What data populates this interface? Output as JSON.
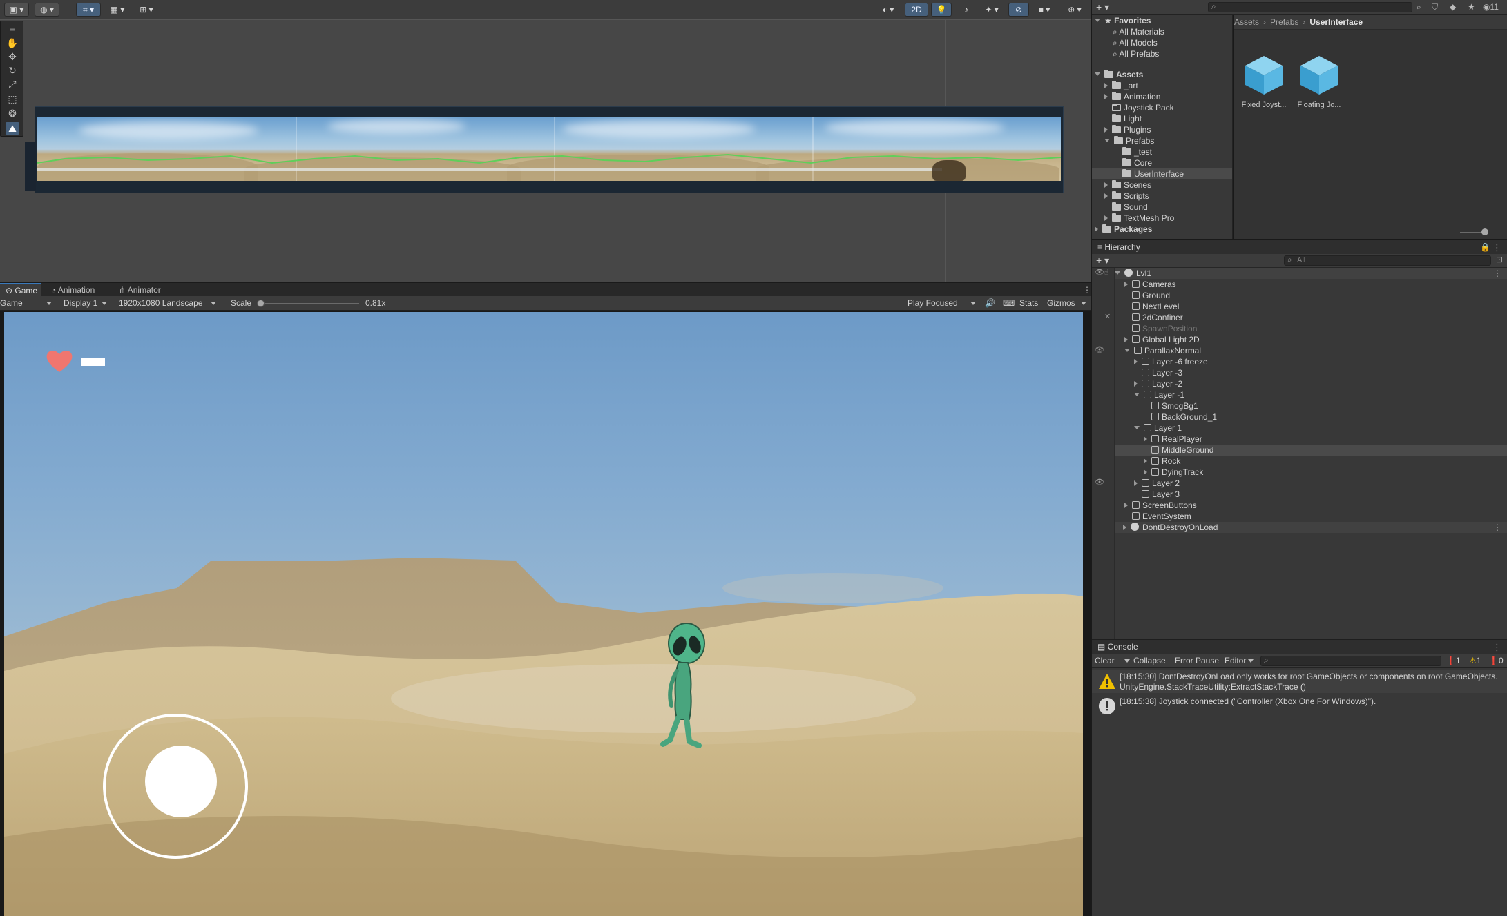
{
  "scene_toolbar": {
    "view_2d_label": "2D",
    "icons": [
      "rect-tool-icon",
      "globe-icon",
      "grid-snap-icon",
      "grid-icon",
      "ruler-icon",
      "shading-icon",
      "lighting-icon",
      "audio-icon",
      "effects-icon",
      "visibility-icon",
      "camera-icon",
      "gizmo-icon"
    ]
  },
  "scene_tools": [
    "hand-tool-icon",
    "move-tool-icon",
    "rotate-tool-icon",
    "scale-tool-icon",
    "rect-tool-icon",
    "transform-tool-icon",
    "custom-tool-icon"
  ],
  "game_tabs": [
    {
      "label": "Game",
      "icon": "game-icon"
    },
    {
      "label": "Animation",
      "icon": "animation-icon"
    },
    {
      "label": "Animator",
      "icon": "animator-icon"
    }
  ],
  "game_toolbar": {
    "mode": "Game",
    "display": "Display 1",
    "resolution": "1920x1080 Landscape",
    "scale_label": "Scale",
    "scale_value": "0.81x",
    "scale_fraction": 0.06,
    "play_mode": "Play Focused",
    "stats": "Stats",
    "gizmos": "Gizmos"
  },
  "game_hud": {
    "heart_color": "#f0766f",
    "joystick_color": "#ffffff"
  },
  "project": {
    "favorites_label": "Favorites",
    "favorites": [
      "All Materials",
      "All Models",
      "All Prefabs"
    ],
    "assets_label": "Assets",
    "assets_children": [
      "_art",
      "Animation",
      "Joystick Pack",
      "Light",
      "Plugins",
      "Prefabs"
    ],
    "prefabs_children": [
      "_test",
      "Core",
      "UserInterface"
    ],
    "after_prefabs": [
      "Scenes",
      "Scripts",
      "Sound",
      "TextMesh Pro"
    ],
    "packages_label": "Packages",
    "breadcrumb": [
      "Assets",
      "Prefabs",
      "UserInterface"
    ],
    "asset_items": [
      {
        "name": "Fixed Joyst...",
        "icon": "prefab-icon"
      },
      {
        "name": "Floating Jo...",
        "icon": "prefab-icon"
      }
    ]
  },
  "hierarchy": {
    "title": "Hierarchy",
    "search_placeholder": "All",
    "root": "Lvl1",
    "rows": [
      {
        "label": "Cameras",
        "depth": 1,
        "arrow": "right"
      },
      {
        "label": "Ground",
        "depth": 1,
        "arrow": ""
      },
      {
        "label": "NextLevel",
        "depth": 1,
        "arrow": ""
      },
      {
        "label": "2dConfiner",
        "depth": 1,
        "arrow": ""
      },
      {
        "label": "SpawnPosition",
        "depth": 1,
        "arrow": "",
        "dim": true
      },
      {
        "label": "Global Light 2D",
        "depth": 1,
        "arrow": "right"
      },
      {
        "label": "ParallaxNormal",
        "depth": 1,
        "arrow": "down"
      },
      {
        "label": "Layer -6 freeze",
        "depth": 2,
        "arrow": "right"
      },
      {
        "label": "Layer -3",
        "depth": 2,
        "arrow": ""
      },
      {
        "label": "Layer -2",
        "depth": 2,
        "arrow": "right"
      },
      {
        "label": "Layer -1",
        "depth": 2,
        "arrow": "down"
      },
      {
        "label": "SmogBg1",
        "depth": 3,
        "arrow": ""
      },
      {
        "label": "BackGround_1",
        "depth": 3,
        "arrow": ""
      },
      {
        "label": "Layer 1",
        "depth": 2,
        "arrow": "down"
      },
      {
        "label": "RealPlayer",
        "depth": 3,
        "arrow": "right"
      },
      {
        "label": "MiddleGround",
        "depth": 3,
        "arrow": "",
        "selected": true
      },
      {
        "label": "Rock",
        "depth": 3,
        "arrow": "right"
      },
      {
        "label": "DyingTrack",
        "depth": 3,
        "arrow": "right"
      },
      {
        "label": "Layer 2",
        "depth": 2,
        "arrow": "right"
      },
      {
        "label": "Layer 3",
        "depth": 2,
        "arrow": ""
      },
      {
        "label": "ScreenButtons",
        "depth": 1,
        "arrow": "right"
      },
      {
        "label": "EventSystem",
        "depth": 1,
        "arrow": ""
      }
    ],
    "dont_destroy": "DontDestroyOnLoad"
  },
  "console": {
    "title": "Console",
    "clear": "Clear",
    "collapse": "Collapse",
    "error_pause": "Error Pause",
    "editor": "Editor",
    "count_info": "1",
    "count_warning": "1",
    "count_error": "0",
    "messages": [
      {
        "type": "warning",
        "icon": "warning-icon",
        "line1": "[18:15:30] DontDestroyOnLoad only works for root GameObjects or components on root GameObjects.",
        "line2": "UnityEngine.StackTraceUtility:ExtractStackTrace ()"
      },
      {
        "type": "info",
        "icon": "info-icon",
        "line1": "[18:15:38] Joystick connected (\"Controller (Xbox One For Windows)\").",
        "line2": ""
      }
    ]
  },
  "top_right": {
    "layers_count": "11"
  }
}
